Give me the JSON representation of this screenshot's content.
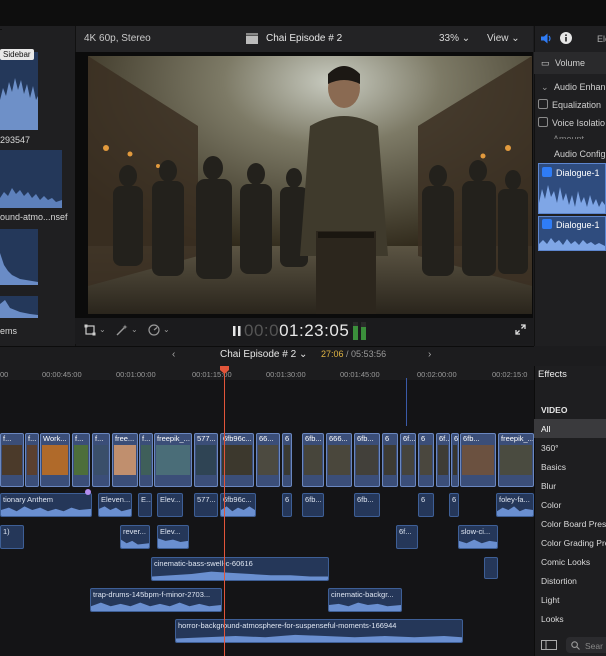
{
  "viewer": {
    "format": "4K 60p, Stereo",
    "project_title": "Chai Episode # 2",
    "zoom": "33%",
    "view_menu": "View",
    "timecode_dim": "00:0",
    "timecode": "01:23:05"
  },
  "browser": {
    "tooltip": "Sidebar",
    "labels": [
      "293547",
      "ound-atmo...nsef",
      "ems"
    ]
  },
  "inspector": {
    "tab_label": "Ele",
    "volume": "Volume",
    "audio_enhancements": "Audio Enhan",
    "equalization": "Equalization",
    "voice_isolation": "Voice Isolatio",
    "amount": "Amount",
    "audio_config": "Audio Config",
    "dialogue_1": "Dialogue-1",
    "dialogue_2": "Dialogue-1"
  },
  "timeline": {
    "project_title": "Chai Episode # 2",
    "duration_current": "27:06",
    "duration_sep": " / ",
    "duration_total": "05:53:56",
    "ruler": [
      "00:00:45:00",
      "00:01:00:00",
      "00:01:15:00",
      "00:01:30:00",
      "00:01:45:00",
      "00:02:00:00",
      "00:02:15:0"
    ],
    "ruler_left": "00",
    "video_clips": [
      "f...",
      "f...",
      "Work...",
      "f...",
      "f...",
      "free...",
      "f...",
      "freepik_...",
      "577...",
      "6fb96c...",
      "66...",
      "6",
      "6fb...",
      "666...",
      "6fb...",
      "6",
      "6f...",
      "6",
      "6f...",
      "6",
      "6fb...",
      "freepik_..."
    ],
    "audio_row1": [
      "tionary Anthem",
      "Eleven...",
      "E...",
      "Elev...",
      "577...",
      "6fb96c...",
      "6",
      "6fb...",
      "6fb...",
      "6",
      "6",
      "foley-fa..."
    ],
    "audio_row2": [
      "1)",
      "rever...",
      "Elev...",
      "6f...",
      "slow-ci..."
    ],
    "audio_row3": [
      "cinematic-bass-swell-c-60616"
    ],
    "audio_row4": [
      "trap-drums-145bpm-f-minor-2703...",
      "cinematic-backgr..."
    ],
    "audio_row5": [
      "horror-background-atmosphere-for-suspenseful-moments-166944"
    ]
  },
  "effects": {
    "header": "Effects",
    "section": "VIDEO",
    "items": [
      "All",
      "360°",
      "Basics",
      "Blur",
      "Color",
      "Color Board Pres",
      "Color Grading Pre",
      "Comic Looks",
      "Distortion",
      "Light",
      "Looks"
    ],
    "search_placeholder": "Sear"
  },
  "colors": {
    "accent_blue": "#2f7cf6",
    "clip_blue": "#2c3f63",
    "playhead": "#e2553a",
    "duration_yellow": "#e0b443"
  },
  "icons": [
    "search-icon",
    "clapper-icon",
    "speaker-icon",
    "info-icon",
    "play-pause-icon",
    "fullscreen-icon",
    "transform-icon",
    "magic-wand-icon",
    "speed-icon",
    "chevron-left-icon",
    "chevron-right-icon"
  ]
}
